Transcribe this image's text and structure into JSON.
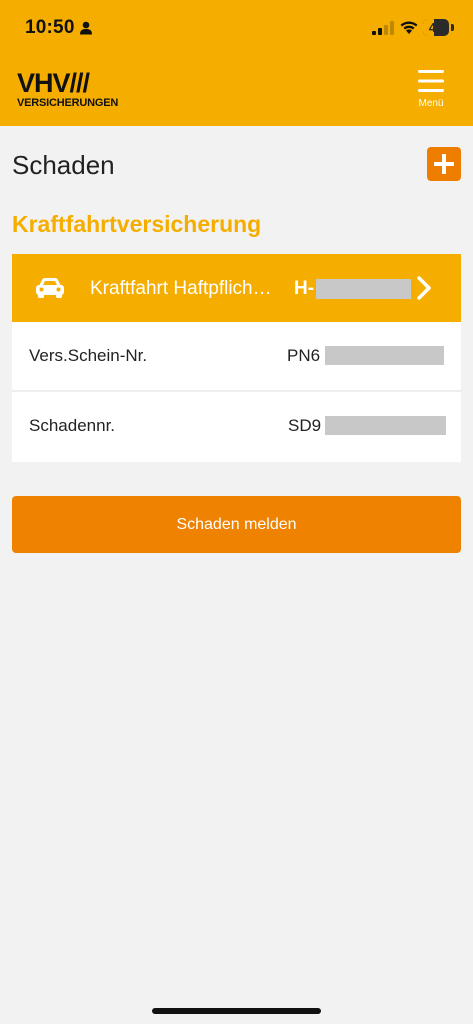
{
  "status_bar": {
    "time": "10:50",
    "battery": "43"
  },
  "header": {
    "logo_top": "VHV///",
    "logo_bottom": "VERSICHERUNGEN",
    "menu_label": "Menü"
  },
  "page": {
    "title": "Schaden"
  },
  "section": {
    "title": "Kraftfahrtversicherung"
  },
  "contract": {
    "name": "Kraftfahrt Haftpflich…",
    "plate_prefix": "H-",
    "rows": [
      {
        "label": "Vers.Schein-Nr.",
        "value_prefix": "PN6"
      },
      {
        "label": "Schadennr.",
        "value_prefix": "SD9"
      }
    ]
  },
  "actions": {
    "report_label": "Schaden melden"
  },
  "colors": {
    "brand_yellow": "#f5ae00",
    "accent_orange": "#ef8200"
  }
}
